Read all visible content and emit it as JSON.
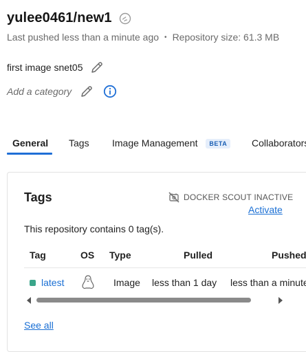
{
  "repo": {
    "name": "yulee0461/new1",
    "last_pushed": "Last pushed less than a minute ago",
    "separator": "•",
    "size": "Repository size: 61.3 MB",
    "description": "first image snet05",
    "category_placeholder": "Add a category"
  },
  "tabs": [
    {
      "label": "General",
      "active": true
    },
    {
      "label": "Tags",
      "active": false
    },
    {
      "label": "Image Management",
      "badge": "BETA",
      "active": false
    },
    {
      "label": "Collaborators",
      "active": false
    }
  ],
  "tags_card": {
    "title": "Tags",
    "scout_status": "DOCKER SCOUT INACTIVE",
    "activate_label": "Activate",
    "count_text": "This repository contains 0 tag(s).",
    "columns": [
      "Tag",
      "OS",
      "Type",
      "Pulled",
      "Pushed"
    ],
    "rows": [
      {
        "tag": "latest",
        "os_icon": "linux-icon",
        "type": "Image",
        "pulled": "less than 1 day",
        "pushed": "less than a minute"
      }
    ],
    "see_all_label": "See all"
  },
  "colors": {
    "accent": "#1f6fd6",
    "link": "#1a6fd4",
    "tag_status": "#3aa58a"
  }
}
